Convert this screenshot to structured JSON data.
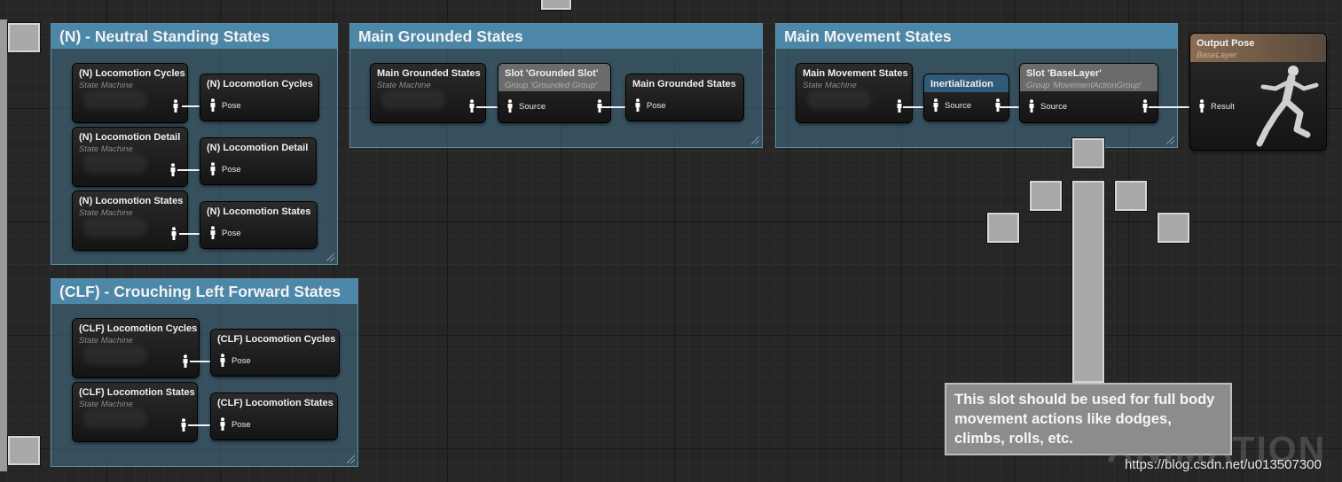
{
  "comments": {
    "neutral": "(N) - Neutral Standing States",
    "crouch": "(CLF) - Crouching Left Forward States",
    "grounded": "Main Grounded States",
    "movement": "Main Movement States"
  },
  "labels": {
    "state_machine": "State Machine",
    "pose": "Pose",
    "source": "Source",
    "result": "Result"
  },
  "nodes": {
    "n_cycles_sm": "(N) Locomotion Cycles",
    "n_cycles_ref": "(N) Locomotion Cycles",
    "n_detail_sm": "(N) Locomotion Detail",
    "n_detail_ref": "(N) Locomotion Detail",
    "n_states_sm": "(N) Locomotion States",
    "n_states_ref": "(N) Locomotion States",
    "clf_cycles_sm": "(CLF) Locomotion Cycles",
    "clf_cycles_ref": "(CLF) Locomotion Cycles",
    "clf_states_sm": "(CLF) Locomotion States",
    "clf_states_ref": "(CLF) Locomotion States",
    "grounded_sm": "Main Grounded States",
    "grounded_slot": "Slot 'Grounded Slot'",
    "grounded_slot_group": "Group 'Grounded Group'",
    "grounded_ref": "Main Grounded States",
    "movement_sm": "Main Movement States",
    "inertialization": "Inertialization",
    "base_slot": "Slot 'BaseLayer'",
    "base_slot_group": "Group 'MovementActionGroup'",
    "output_pose": "Output Pose",
    "output_sub": "BaseLayer"
  },
  "note": "This slot should be used for full body movement actions like dodges, climbs, rolls, etc.",
  "watermark": "ANIMATION",
  "url": "https://blog.csdn.net/u013507300",
  "colors": {
    "comment_header": "#4d87a8",
    "slot_header": "#6b6b6b",
    "inertialization_header": "#2f5a78",
    "output_header": "#8a6c52"
  }
}
